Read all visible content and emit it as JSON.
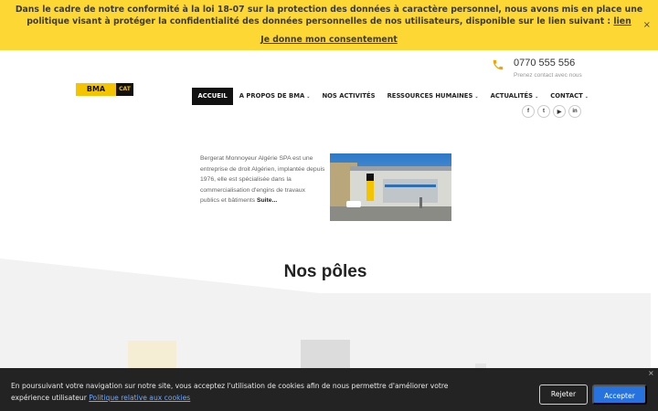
{
  "gdpr": {
    "message": "Dans le cadre de notre conformité à la loi 18-07 sur la protection des données à caractère personnel, nous avons mis en place une politique visant à protéger la confidentialité des données personnelles de nos utilisateurs, disponible sur le lien suivant :",
    "link": "lien",
    "consent": "Je donne mon consentement",
    "close": "×"
  },
  "logo": {
    "left": "BMA",
    "right": "CAT"
  },
  "contact": {
    "phone": "0770 555 556",
    "subtitle": "Prenez contact avec nous"
  },
  "nav": {
    "items": [
      {
        "label": "ACCUEIL",
        "dropdown": false
      },
      {
        "label": "A PROPOS DE BMA",
        "dropdown": true
      },
      {
        "label": "NOS ACTIVITÉS",
        "dropdown": false
      },
      {
        "label": "RESSOURCES HUMAINES",
        "dropdown": true
      },
      {
        "label": "ACTUALITÉS",
        "dropdown": true
      },
      {
        "label": "CONTACT",
        "dropdown": true
      }
    ],
    "caret": "⌄"
  },
  "socials": [
    {
      "name": "facebook",
      "glyph": "f"
    },
    {
      "name": "twitter",
      "glyph": "t"
    },
    {
      "name": "youtube",
      "glyph": "▶"
    },
    {
      "name": "linkedin",
      "glyph": "in"
    }
  ],
  "about": {
    "text": "Bergerat Monnoyeur Algérie SPA est une entreprise de droit  Algérien, implantée depuis 1976, elle est spécialisée dans la commercialisation d'engins de travaux publics et bâtiments",
    "more": "Suite..."
  },
  "poles": {
    "title": "Nos pôles"
  },
  "cookie": {
    "text": "En poursuivant votre navigation sur notre site, vous acceptez l'utilisation de cookies afin de nous permettre d'améliorer votre expérience utilisateur",
    "link": "Politique relative aux cookies",
    "reject": "Rejeter",
    "accept": "Accepter",
    "close": "×"
  },
  "colors": {
    "banner": "#fdd835",
    "brand_yellow": "#f5c400",
    "accept": "#2673e0",
    "cookie_bg": "#232323"
  }
}
